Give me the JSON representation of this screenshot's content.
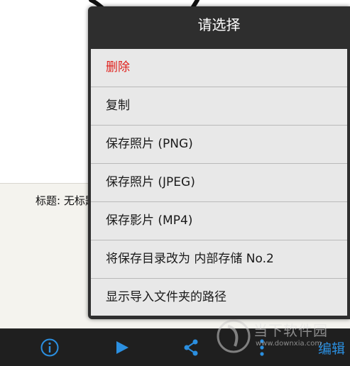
{
  "info": {
    "title_text": "标题: 无标题"
  },
  "dialog": {
    "title": "请选择",
    "items": [
      {
        "label": "删除",
        "danger": true
      },
      {
        "label": "复制"
      },
      {
        "label": "保存照片 (PNG)"
      },
      {
        "label": "保存照片 (JPEG)"
      },
      {
        "label": "保存影片 (MP4)"
      },
      {
        "label": "将保存目录改为 内部存储 No.2"
      },
      {
        "label": "显示导入文件夹的路径"
      }
    ]
  },
  "bottom_bar": {
    "edit_label": "编辑",
    "icons": [
      "info-icon",
      "play-icon",
      "share-icon",
      "more-icon"
    ],
    "accent": "#2b8fe0"
  },
  "watermark": {
    "name": "当下软件园",
    "url": "www.downxia.com"
  },
  "colors": {
    "danger": "#e0201c",
    "dialog_bg": "#2e2e2e",
    "item_bg": "#e8e8e8"
  }
}
